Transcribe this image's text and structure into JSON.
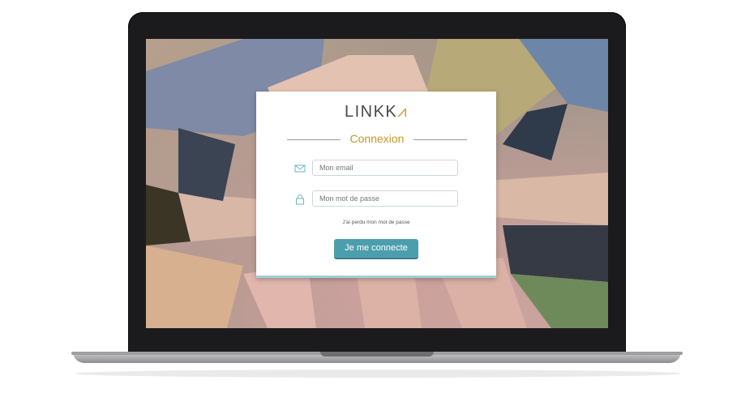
{
  "login": {
    "logo_text": "LINKK",
    "title": "Connexion",
    "email_placeholder": "Mon email",
    "password_placeholder": "Mon mot de passe",
    "forgot_link": "J'ai perdu mon mot de passe",
    "submit_label": "Je me connecte"
  },
  "icons": {
    "email": "envelope-icon",
    "password": "lock-icon"
  },
  "colors": {
    "accent": "#4b9fad",
    "title": "#c8962a"
  }
}
